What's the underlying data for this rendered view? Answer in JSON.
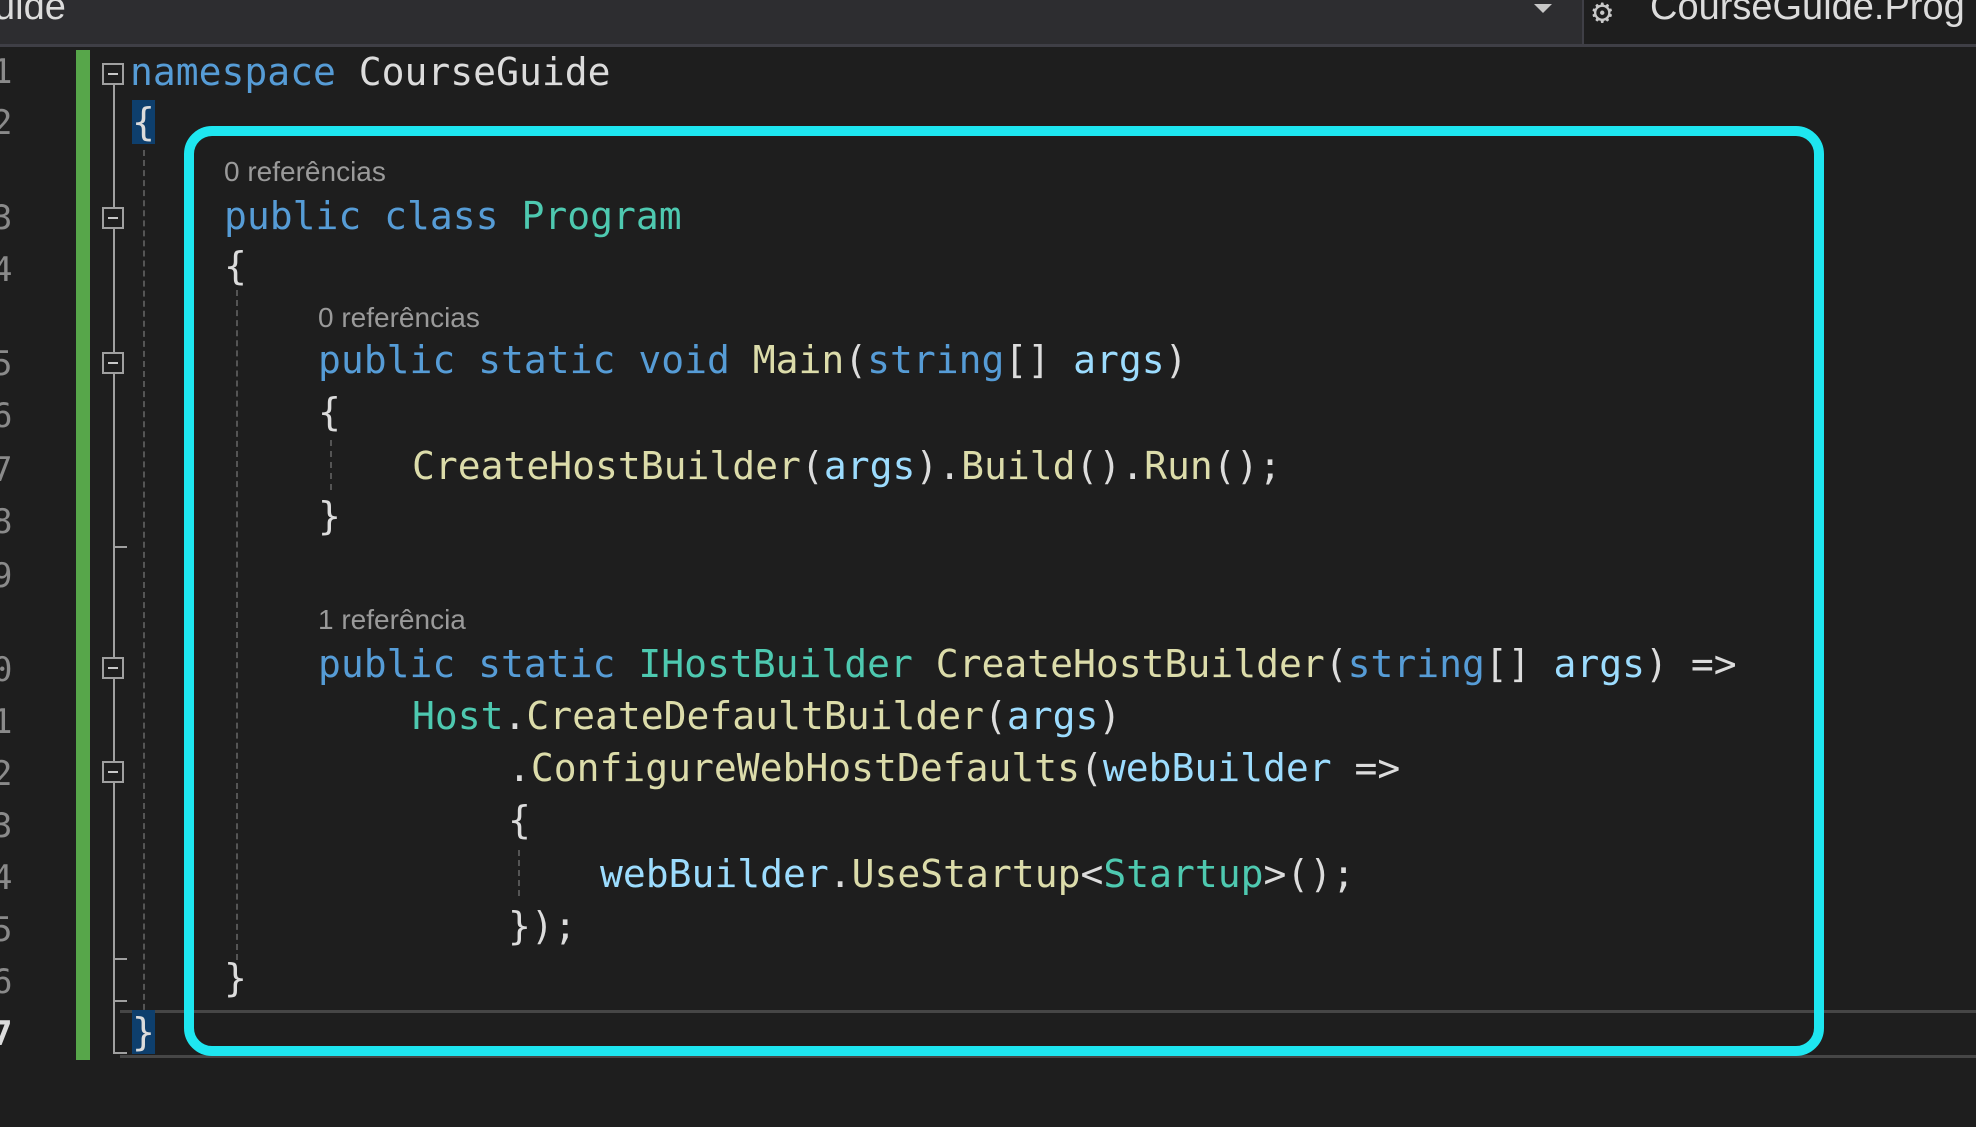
{
  "top_bar": {
    "project_label": "uide",
    "member_combo": "CourseGuide.Prog"
  },
  "editor": {
    "line_numbers": [
      "1",
      "2",
      "3",
      "4",
      "5",
      "6",
      "7",
      "8",
      "9",
      "0",
      "1",
      "2",
      "3",
      "4",
      "5",
      "6",
      "7"
    ],
    "lens": {
      "class_refs": "0 referências",
      "main_refs": "0 referências",
      "builder_refs": "1 referência"
    },
    "code": {
      "kw_namespace": "namespace",
      "namespace_name": "CourseGuide",
      "brace_open": "{",
      "brace_close": "}",
      "kw_public": "public",
      "kw_class": "class",
      "class_name": "Program",
      "kw_static": "static",
      "kw_void": "void",
      "method_main": "Main",
      "paren_open": "(",
      "paren_close": ")",
      "kw_string": "string",
      "array_brackets": "[]",
      "param_args": "args",
      "call_create_host_builder": "CreateHostBuilder",
      "dot": ".",
      "call_build": "Build",
      "call_run": "Run",
      "empty_call": "()",
      "empty_call_end": "();",
      "type_ihostbuilder": "IHostBuilder",
      "arrow": "=>",
      "type_host": "Host",
      "call_create_default_builder": "CreateDefaultBuilder",
      "call_configure_web_host_defaults": "ConfigureWebHostDefaults",
      "param_web_builder": "webBuilder",
      "call_use_startup": "UseStartup",
      "lt": "<",
      "gt": ">",
      "type_startup": "Startup",
      "close_lambda": "});"
    }
  },
  "annotation": {
    "color": "#1ee6f0"
  }
}
